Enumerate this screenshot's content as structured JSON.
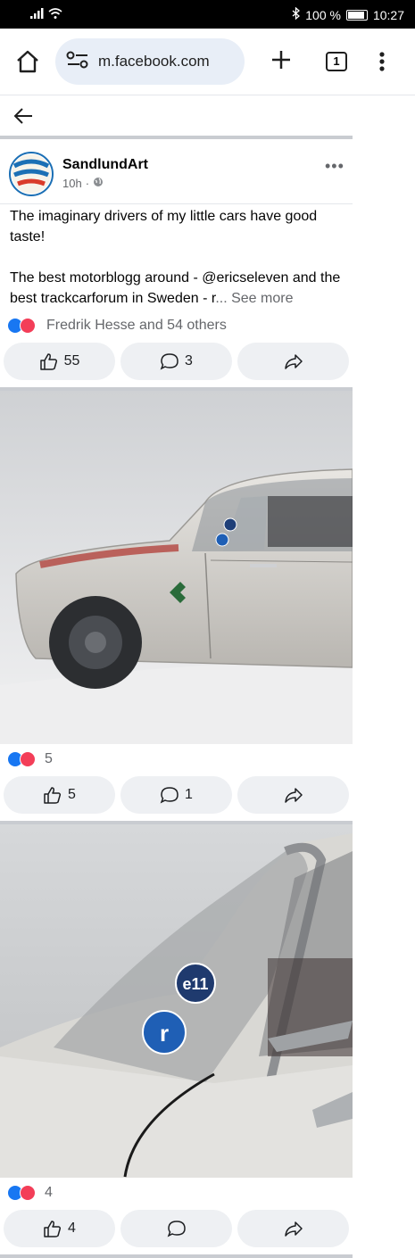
{
  "status_bar": {
    "battery": "100 %",
    "time": "10:27"
  },
  "browser": {
    "url": "m.facebook.com",
    "tab_count": "1"
  },
  "post": {
    "author": "SandlundArt",
    "time": "10h",
    "separator": "·",
    "more": "•••",
    "caption_line1": "The imaginary drivers of my little cars have good taste!",
    "caption_line2": "The best motorblogg around - @ericseleven and the best trackcarforum in Sweden - r",
    "see_more": "... See more",
    "reactions_text": "Fredrik Hesse and 54 others",
    "like_count": "55",
    "comment_count": "3"
  },
  "photo1": {
    "reactions_count": "5",
    "like_count": "5",
    "comment_count": "1"
  },
  "photo2": {
    "reactions_count": "4",
    "like_count": "4"
  },
  "decals": {
    "e11": "e11",
    "r": "r"
  }
}
